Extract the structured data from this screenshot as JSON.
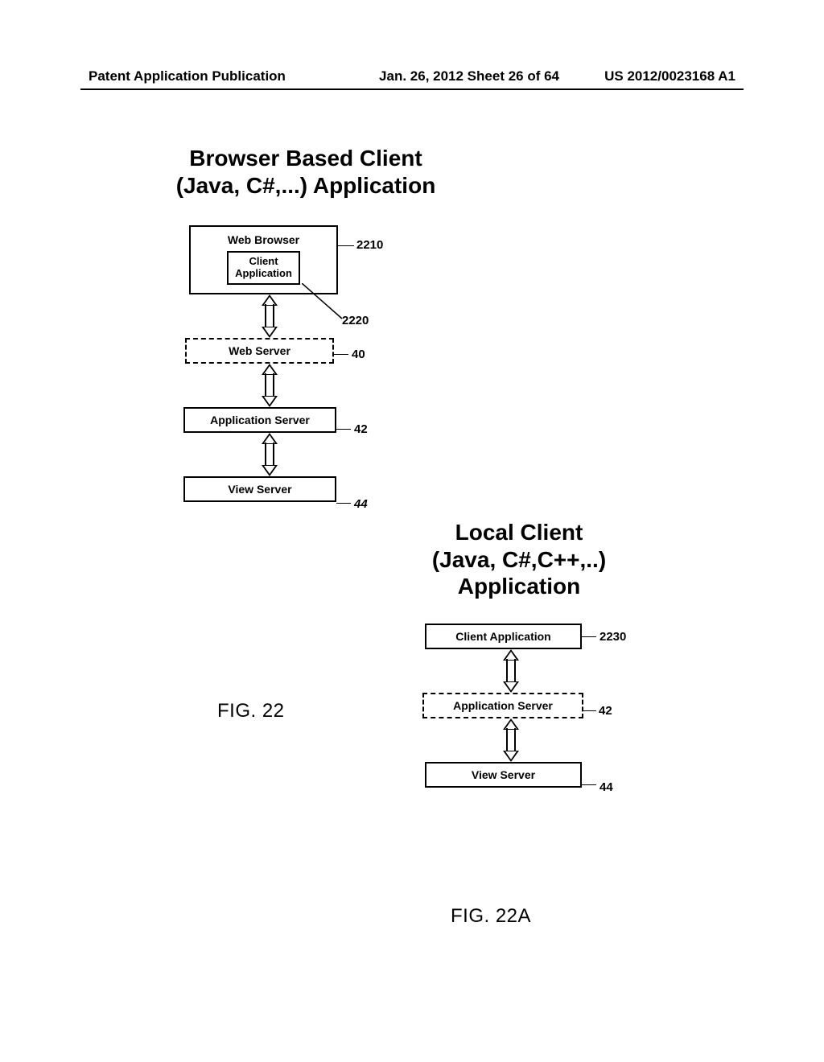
{
  "header": {
    "left": "Patent Application Publication",
    "center": "Jan. 26, 2012  Sheet 26 of 64",
    "right": "US 2012/0023168 A1"
  },
  "titles": {
    "browser_title_1": "Browser Based Client",
    "browser_title_2": "(Java, C#,...) Application",
    "local_title_1": "Local Client",
    "local_title_2": "(Java, C#,C++,..)",
    "local_title_3": "Application"
  },
  "d1": {
    "web_browser": "Web Browser",
    "client_app": "Client\nApplication",
    "web_server": "Web Server",
    "app_server": "Application Server",
    "view_server": "View Server"
  },
  "d2": {
    "client_app": "Client  Application",
    "app_server": "Application Server",
    "view_server": "View Server"
  },
  "refs": {
    "r2210": "2210",
    "r2220": "2220",
    "r40": "40",
    "r42": "42",
    "r44": "44",
    "r2230": "2230"
  },
  "captions": {
    "fig22": "FIG. 22",
    "fig22a": "FIG. 22A"
  }
}
